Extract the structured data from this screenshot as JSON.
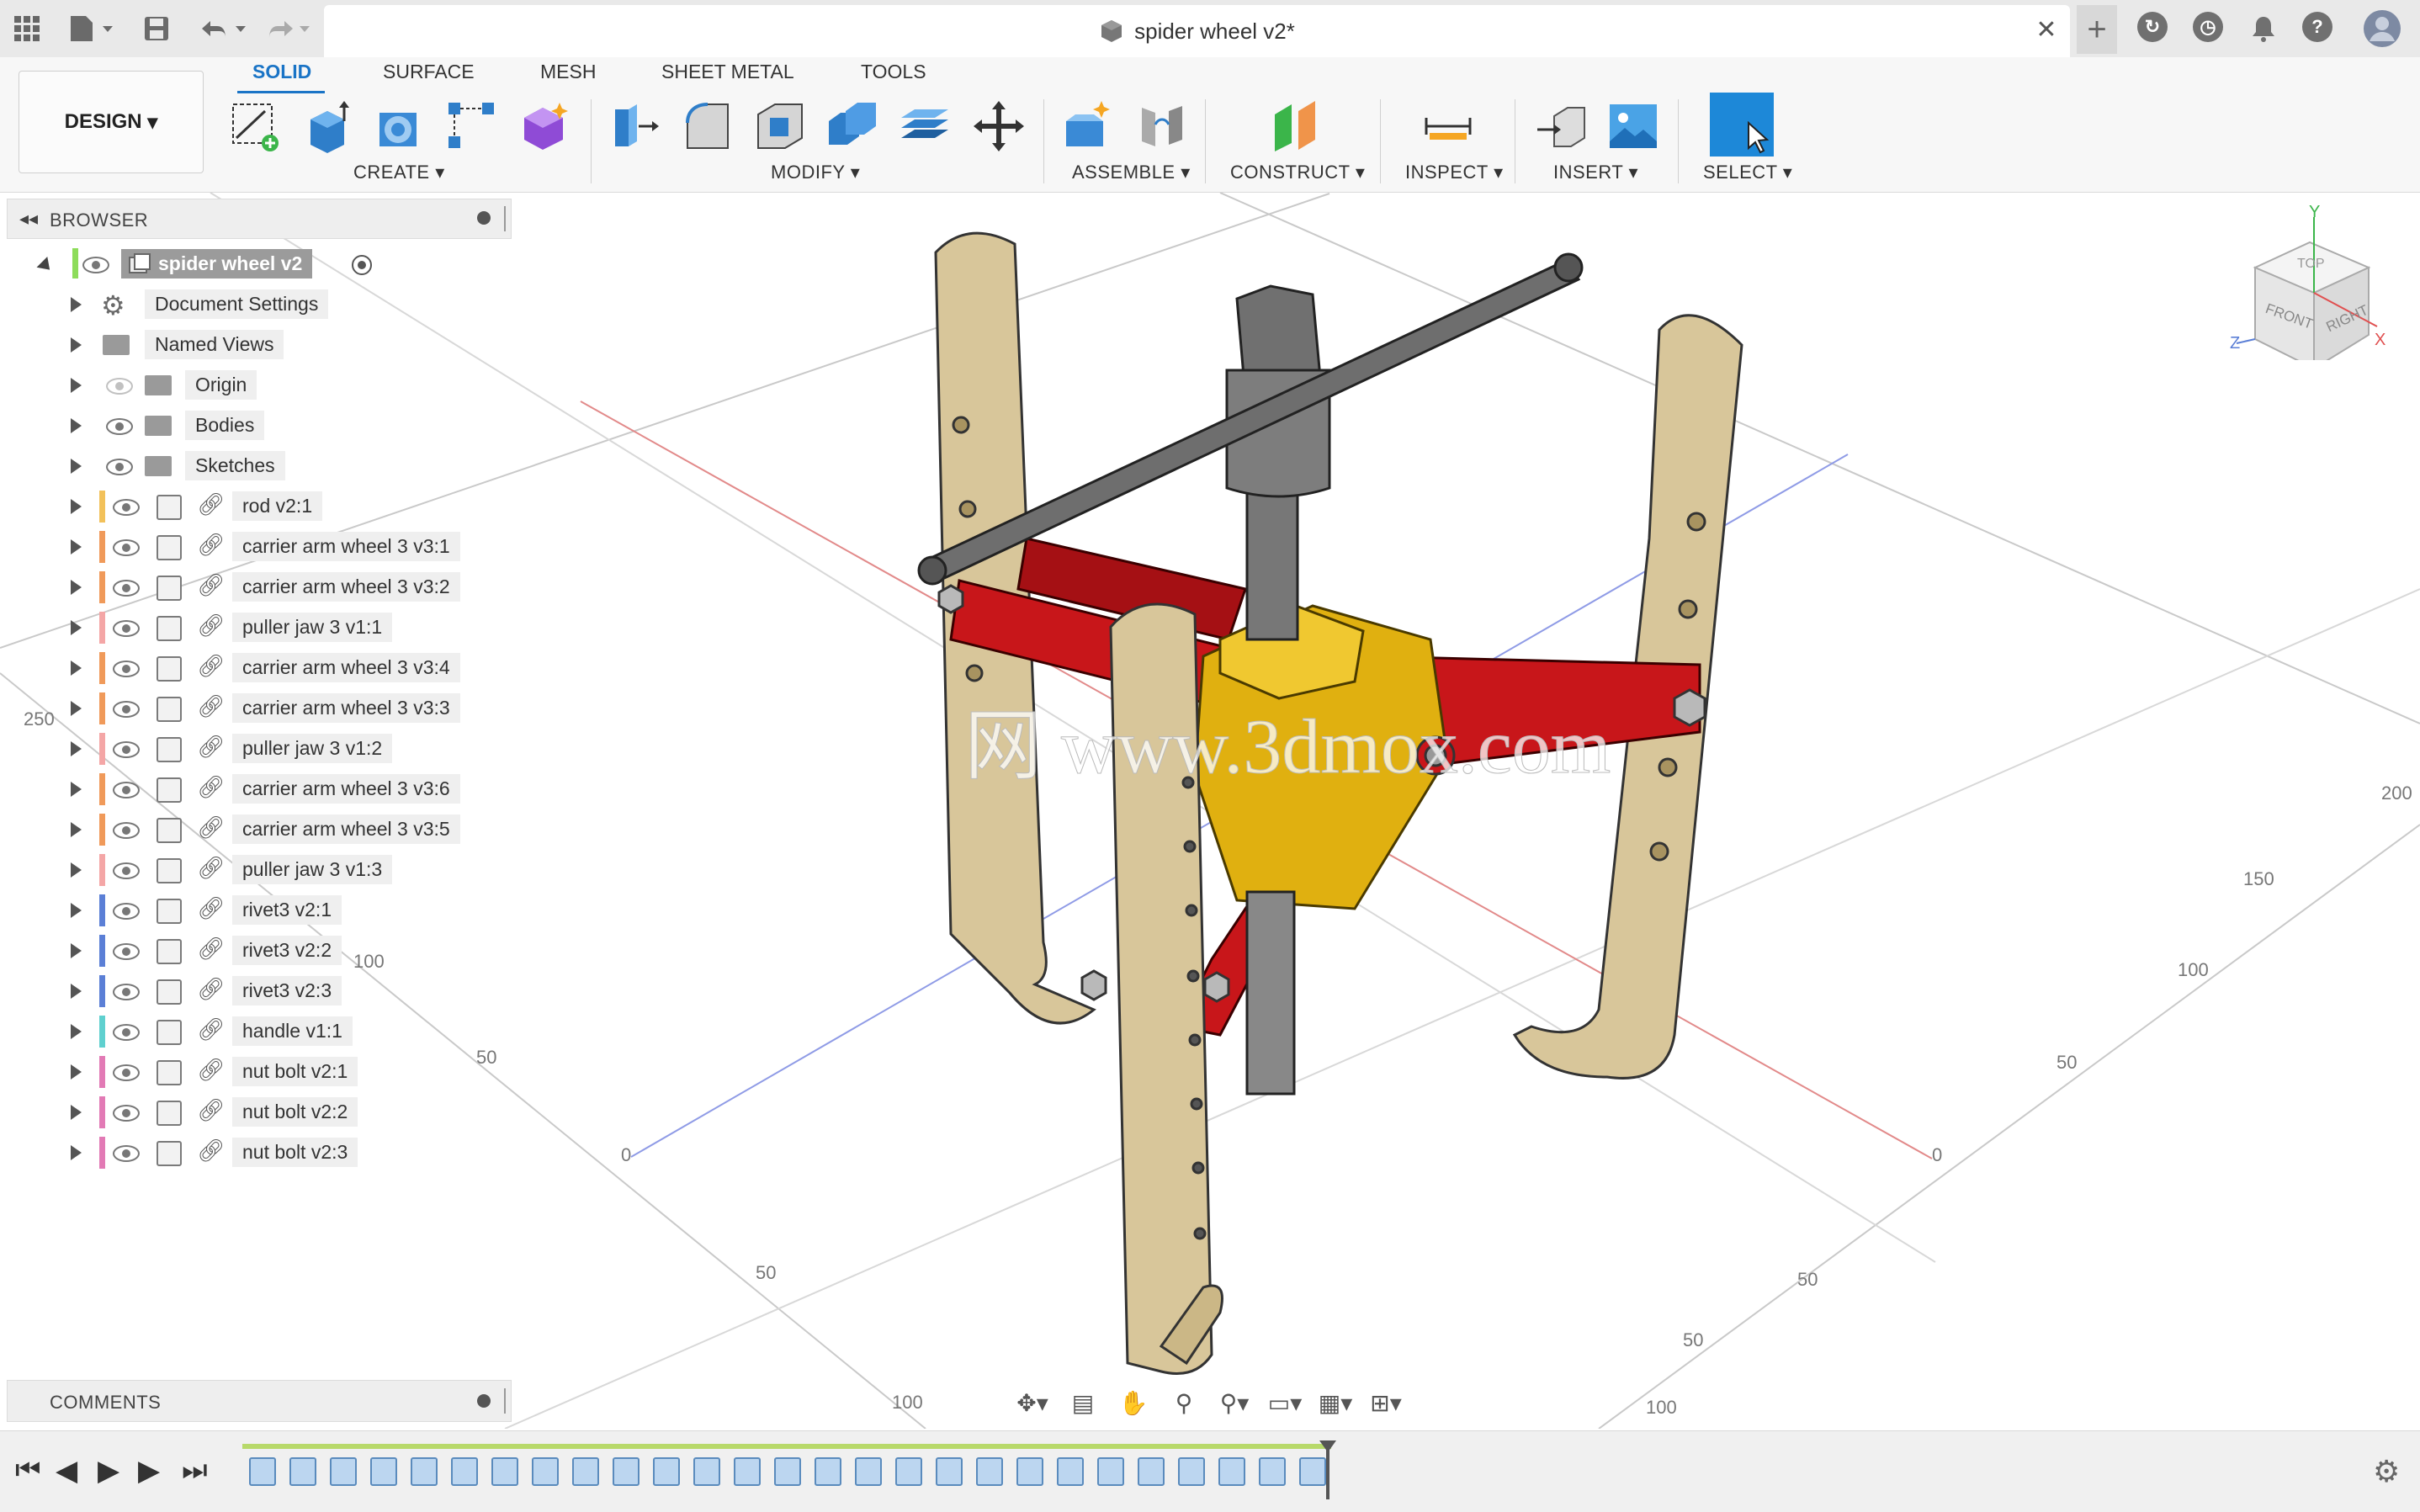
{
  "titlebar": {
    "doc_title": "spider wheel v2*",
    "icons": [
      "apps-grid-icon",
      "file-menu-icon",
      "save-icon",
      "undo-icon",
      "redo-icon",
      "close-icon",
      "new-tab-icon",
      "extensions-icon",
      "job-status-icon",
      "notifications-icon",
      "help-icon",
      "user-avatar-icon"
    ]
  },
  "toolbar": {
    "workspace": "DESIGN",
    "tabs": [
      "SOLID",
      "SURFACE",
      "MESH",
      "SHEET METAL",
      "TOOLS"
    ],
    "active_tab": "SOLID",
    "groups": {
      "create": "CREATE",
      "modify": "MODIFY",
      "assemble": "ASSEMBLE",
      "construct": "CONSTRUCT",
      "inspect": "INSPECT",
      "insert": "INSERT",
      "select": "SELECT"
    }
  },
  "browser": {
    "title": "BROWSER",
    "root": "spider wheel v2",
    "folders": [
      {
        "label": "Document Settings",
        "icon": "gear-icon"
      },
      {
        "label": "Named Views",
        "icon": "folder-icon"
      },
      {
        "label": "Origin",
        "icon": "folder-icon"
      },
      {
        "label": "Bodies",
        "icon": "folder-icon"
      },
      {
        "label": "Sketches",
        "icon": "folder-icon"
      }
    ],
    "components": [
      {
        "label": "rod v2:1",
        "color": "#f2c15a"
      },
      {
        "label": "carrier arm wheel 3 v3:1",
        "color": "#f09a5a"
      },
      {
        "label": "carrier arm wheel 3 v3:2",
        "color": "#f09a5a"
      },
      {
        "label": "puller jaw 3 v1:1",
        "color": "#f4a6a6"
      },
      {
        "label": "carrier arm wheel 3 v3:4",
        "color": "#f09a5a"
      },
      {
        "label": "carrier arm wheel 3 v3:3",
        "color": "#f09a5a"
      },
      {
        "label": "puller jaw 3 v1:2",
        "color": "#f4a6a6"
      },
      {
        "label": "carrier arm wheel 3 v3:6",
        "color": "#f09a5a"
      },
      {
        "label": "carrier arm wheel 3 v3:5",
        "color": "#f09a5a"
      },
      {
        "label": "puller jaw 3 v1:3",
        "color": "#f4a6a6"
      },
      {
        "label": "rivet3 v2:1",
        "color": "#5b7fd6"
      },
      {
        "label": "rivet3 v2:2",
        "color": "#5b7fd6"
      },
      {
        "label": "rivet3 v2:3",
        "color": "#5b7fd6"
      },
      {
        "label": "handle v1:1",
        "color": "#5fd0cf"
      },
      {
        "label": "nut bolt v2:1",
        "color": "#e27ab5"
      },
      {
        "label": "nut bolt v2:2",
        "color": "#e27ab5"
      },
      {
        "label": "nut bolt v2:3",
        "color": "#e27ab5"
      }
    ]
  },
  "comments": {
    "title": "COMMENTS"
  },
  "viewcube": {
    "top": "TOP",
    "front": "FRONT",
    "right": "RIGHT",
    "axis_x": "X",
    "axis_y": "Y",
    "axis_z": "Z"
  },
  "grid_labels": [
    "250",
    "200",
    "150",
    "100",
    "50",
    "0",
    "50",
    "100",
    "50",
    "0",
    "50",
    "100",
    "50",
    "100"
  ],
  "watermark": "网 www.3dmox.com",
  "colors": {
    "accent": "#1a74c6",
    "select_blue": "#1d88d8",
    "jaw": "#d8c69a",
    "arm": "#c8161a",
    "hub": "#e0b010",
    "steel": "#6e6e6e"
  }
}
